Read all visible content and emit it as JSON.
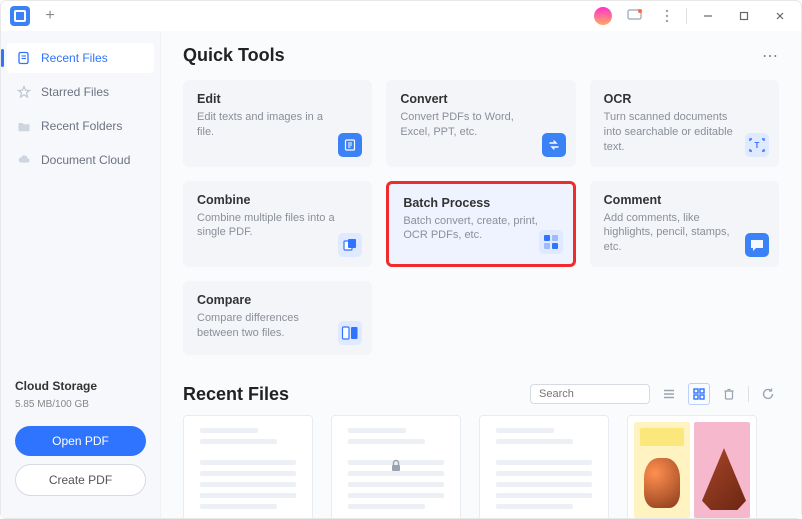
{
  "sidebar": {
    "items": [
      {
        "label": "Recent Files"
      },
      {
        "label": "Starred Files"
      },
      {
        "label": "Recent Folders"
      },
      {
        "label": "Document Cloud"
      }
    ],
    "storage": {
      "title": "Cloud Storage",
      "usage": "5.85 MB/100 GB"
    },
    "buttons": {
      "open": "Open PDF",
      "create": "Create PDF"
    }
  },
  "main": {
    "quick_tools_title": "Quick Tools",
    "tools": [
      {
        "title": "Edit",
        "desc": "Edit texts and images in a file."
      },
      {
        "title": "Convert",
        "desc": "Convert PDFs to Word, Excel, PPT, etc."
      },
      {
        "title": "OCR",
        "desc": "Turn scanned documents into searchable or editable text."
      },
      {
        "title": "Combine",
        "desc": "Combine multiple files into a single PDF."
      },
      {
        "title": "Batch Process",
        "desc": "Batch convert, create, print, OCR PDFs, etc."
      },
      {
        "title": "Comment",
        "desc": "Add comments, like highlights, pencil, stamps, etc."
      },
      {
        "title": "Compare",
        "desc": "Compare differences between two files."
      }
    ],
    "recent_title": "Recent Files",
    "search_placeholder": "Search"
  }
}
